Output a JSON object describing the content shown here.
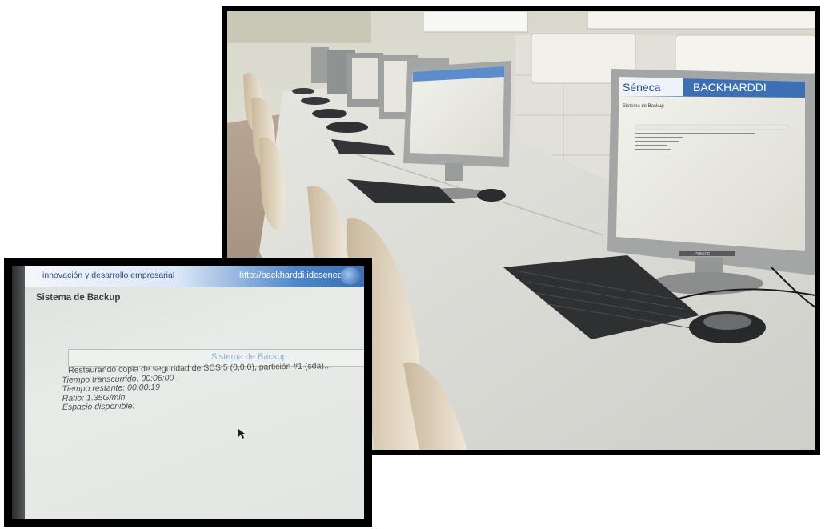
{
  "main_photo": {
    "left_monitor": {
      "brand_text": "Séneca",
      "app_title": "BACKHARDDI",
      "section_title": "Sistema de Backup",
      "bezel_brand": "PHILIPS"
    }
  },
  "inset_photo": {
    "tagline": "innovación y desarrollo empresarial",
    "url": "http://backharddi.ideseneca.es",
    "section_title": "Sistema de Backup",
    "panel_title": "Sistema de Backup",
    "status_lines": [
      "Restaurando copia de seguridad de SCSI5 (0,0,0), partición #1 (sda)...",
      "Tiempo transcurrido: 00:06:00",
      "Tiempo restante: 00:00:19",
      "Ratio: 1.35G/min",
      "Espacio disponible:"
    ]
  },
  "colors": {
    "desk": "#dcdcd6",
    "wall": "#e9e7de",
    "header_blue": "#3c6fb4",
    "monitor_grey": "#a4a6a6",
    "keyboard": "#2e3032"
  }
}
